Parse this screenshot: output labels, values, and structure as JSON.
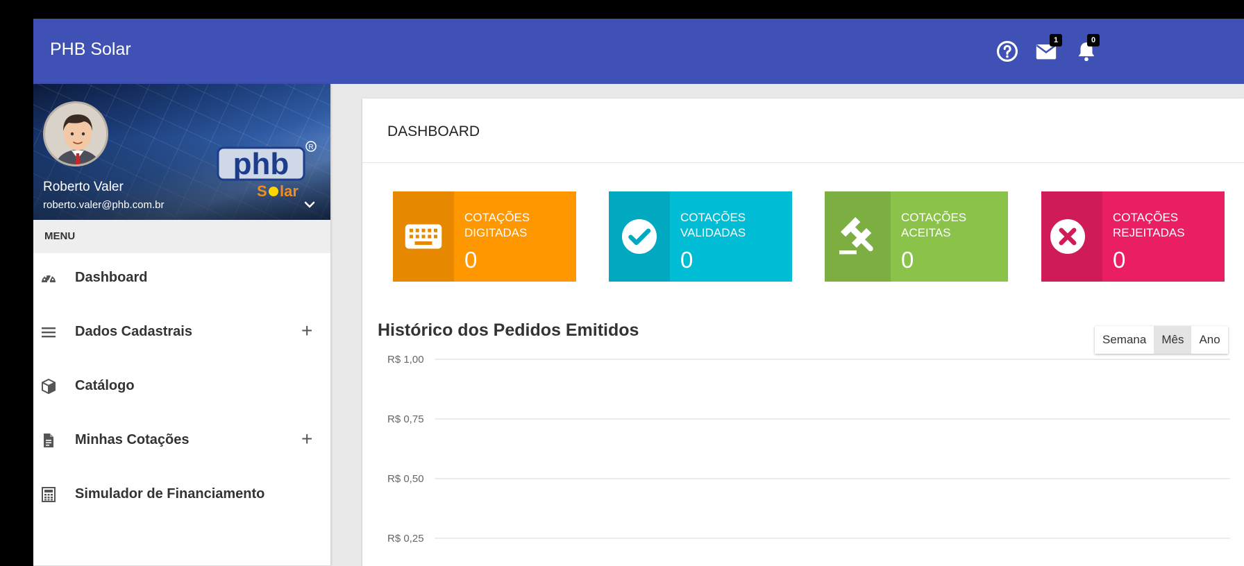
{
  "app": {
    "title": "PHB Solar"
  },
  "topbar": {
    "icons": [
      {
        "name": "help-icon",
        "badge": ""
      },
      {
        "name": "mail-icon",
        "badge": "1"
      },
      {
        "name": "bell-icon",
        "badge": "0"
      }
    ]
  },
  "profile": {
    "name": "Roberto Valer",
    "email": "roberto.valer@phb.com.br",
    "brand_logo_text": "phb",
    "brand_logo_sub": "Solar"
  },
  "sidebar": {
    "menu_header": "MENU",
    "items": [
      {
        "label": "Dashboard",
        "icon": "dashboard-icon",
        "expandable": false
      },
      {
        "label": "Dados Cadastrais",
        "icon": "list-icon",
        "expandable": true
      },
      {
        "label": "Catálogo",
        "icon": "box-icon",
        "expandable": false
      },
      {
        "label": "Minhas Cotações",
        "icon": "document-icon",
        "expandable": true
      },
      {
        "label": "Simulador de Financiamento",
        "icon": "calculator-icon",
        "expandable": false
      }
    ],
    "expand_symbol": "+"
  },
  "main": {
    "page_title": "DASHBOARD",
    "stats": [
      {
        "line1": "COTAÇÕES",
        "line2": "DIGITADAS",
        "value": "0",
        "icon": "keyboard-icon",
        "color": "#ff9800",
        "icon_bg": "#e68900"
      },
      {
        "line1": "COTAÇÕES",
        "line2": "VALIDADAS",
        "value": "0",
        "icon": "check-circle-icon",
        "color": "#00bcd4",
        "icon_bg": "#00a9bf"
      },
      {
        "line1": "COTAÇÕES",
        "line2": "ACEITAS",
        "value": "0",
        "icon": "gavel-icon",
        "color": "#8bc34a",
        "icon_bg": "#7dae42"
      },
      {
        "line1": "COTAÇÕES",
        "line2": "REJEITADAS",
        "value": "0",
        "icon": "cancel-circle-icon",
        "color": "#e91e63",
        "icon_bg": "#d01b59"
      }
    ],
    "chart_title": "Histórico dos Pedidos Emitidos",
    "range_buttons": [
      {
        "label": "Semana",
        "active": false
      },
      {
        "label": "Mês",
        "active": true
      },
      {
        "label": "Ano",
        "active": false
      }
    ]
  },
  "chart_data": {
    "type": "line",
    "title": "Histórico dos Pedidos Emitidos",
    "xlabel": "",
    "ylabel": "",
    "y_tick_labels": [
      "R$ 1,00",
      "R$ 0,75",
      "R$ 0,50",
      "R$ 0,25"
    ],
    "y_ticks": [
      1.0,
      0.75,
      0.5,
      0.25
    ],
    "ylim": [
      0,
      1
    ],
    "grid": true,
    "series": []
  }
}
